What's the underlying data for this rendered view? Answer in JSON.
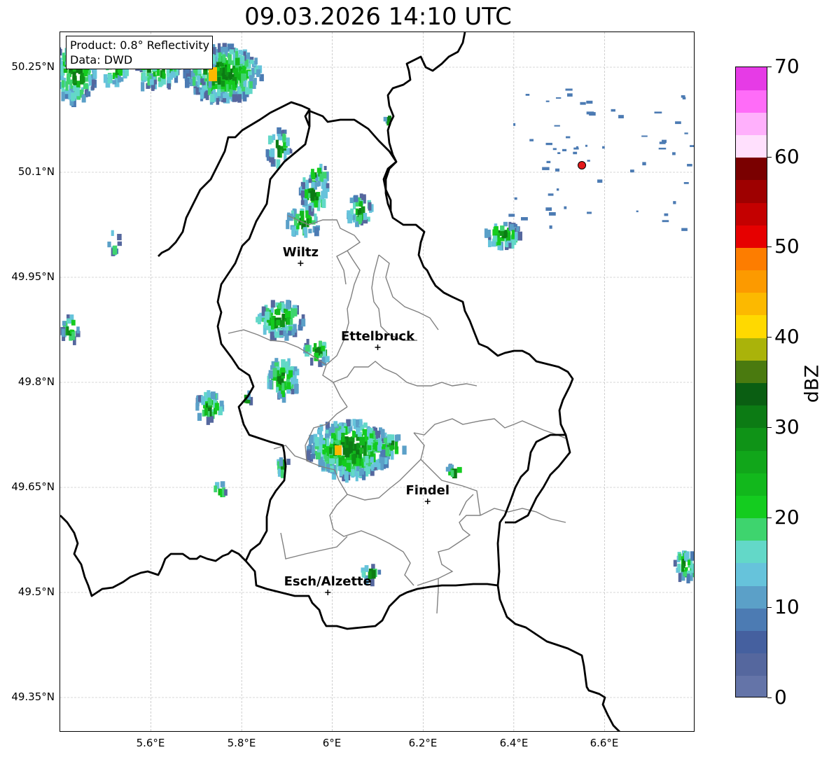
{
  "title": "09.03.2026 14:10 UTC",
  "info_box": {
    "product": "Product: 0.8° Reflectivity",
    "source": "Data: DWD"
  },
  "axes": {
    "lat_labels": [
      "50.25°N",
      "50.1°N",
      "49.95°N",
      "49.8°N",
      "49.65°N",
      "49.5°N",
      "49.35°N"
    ],
    "lon_labels": [
      "5.6°E",
      "5.8°E",
      "6°E",
      "6.2°E",
      "6.4°E",
      "6.6°E"
    ],
    "extent": {
      "lon": [
        5.4,
        6.8
      ],
      "lat": [
        49.3,
        50.3
      ]
    }
  },
  "places": [
    {
      "name": "Wiltz",
      "lon": 5.93,
      "lat": 49.97
    },
    {
      "name": "Ettelbruck",
      "lon": 6.1,
      "lat": 49.85
    },
    {
      "name": "Findel",
      "lon": 6.21,
      "lat": 49.63
    },
    {
      "name": "Esch/Alzette",
      "lon": 5.99,
      "lat": 49.5
    }
  ],
  "radar_site": {
    "lon": 6.55,
    "lat": 50.11,
    "color": "#e31a1c"
  },
  "colorbar": {
    "label": "dBZ",
    "min": 0,
    "max": 70,
    "step": 2.5,
    "tick_labels": [
      "0",
      "10",
      "20",
      "30",
      "40",
      "50",
      "60",
      "70"
    ],
    "colors": [
      "#6474a8",
      "#55679e",
      "#45609f",
      "#4c7bb3",
      "#5ba0c8",
      "#66c3db",
      "#63d8c8",
      "#3ed46e",
      "#14cc1f",
      "#12b81c",
      "#11a61a",
      "#0f9317",
      "#0c7b14",
      "#0a5e12",
      "#4a7a0f",
      "#aab30a",
      "#ffd900",
      "#fcb900",
      "#fc9a00",
      "#fd7d00",
      "#e60000",
      "#c40000",
      "#9e0000",
      "#7a0000",
      "#ffe0fd",
      "#ffb0fc",
      "#ff6cf8",
      "#e63be6"
    ]
  },
  "colors": {
    "border_national": "#000000",
    "border_cantonal": "#808080",
    "grid": "#b0b0b0"
  }
}
